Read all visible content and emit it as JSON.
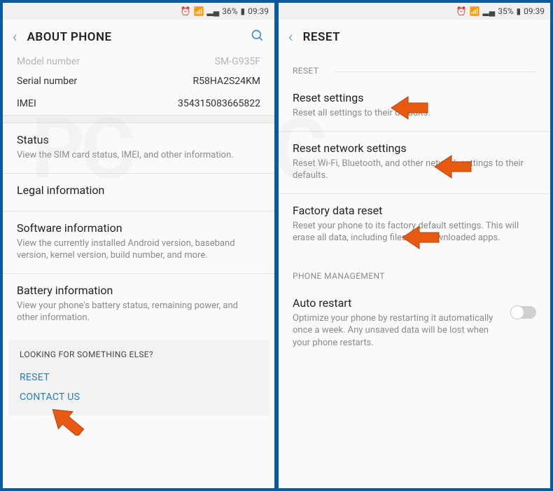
{
  "left": {
    "status": {
      "battery": "36%",
      "time": "09:39"
    },
    "header": {
      "title": "ABOUT PHONE"
    },
    "rows": {
      "model": {
        "label": "Model number",
        "value": "SM-G935F"
      },
      "serial": {
        "label": "Serial number",
        "value": "R58HA2S24KM"
      },
      "imei": {
        "label": "IMEI",
        "value": "354315083665822"
      }
    },
    "items": {
      "status": {
        "title": "Status",
        "desc": "View the SIM card status, IMEI, and other information."
      },
      "legal": {
        "title": "Legal information"
      },
      "software": {
        "title": "Software information",
        "desc": "View the currently installed Android version, baseband version, kernel version, build number, and more."
      },
      "battery": {
        "title": "Battery information",
        "desc": "View your phone's battery status, remaining power, and other information."
      }
    },
    "footer": {
      "heading": "LOOKING FOR SOMETHING ELSE?",
      "reset": "RESET",
      "contact": "CONTACT US"
    }
  },
  "right": {
    "status": {
      "battery": "35%",
      "time": "09:39"
    },
    "header": {
      "title": "RESET"
    },
    "sections": {
      "reset": "RESET",
      "phoneMgmt": "PHONE MANAGEMENT"
    },
    "items": {
      "resetSettings": {
        "title": "Reset settings",
        "desc": "Reset all settings to their defaults."
      },
      "resetNetwork": {
        "title": "Reset network settings",
        "desc": "Reset Wi-Fi, Bluetooth, and other network settings to their defaults."
      },
      "factory": {
        "title": "Factory data reset",
        "desc": "Reset your phone to its factory default settings. This will erase all data, including files and downloaded apps."
      },
      "autoRestart": {
        "title": "Auto restart",
        "desc": "Optimize your phone by restarting it automatically once a week. Any unsaved data will be lost when your phone restarts."
      }
    }
  }
}
